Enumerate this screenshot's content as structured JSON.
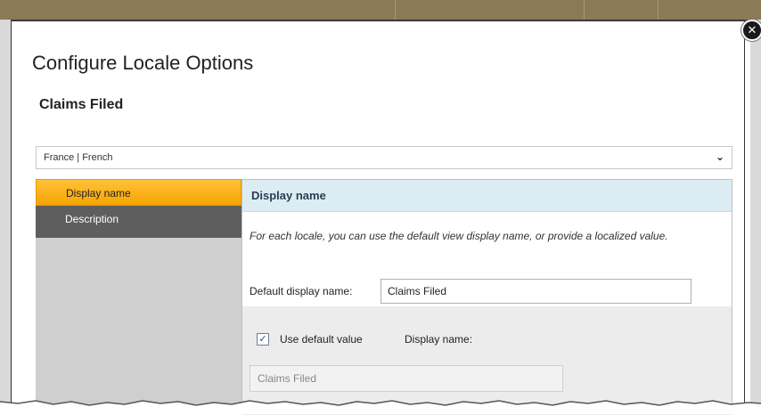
{
  "dialog": {
    "title": "Configure Locale Options",
    "subtitle": "Claims Filed",
    "close_icon": "close-icon",
    "locale_selected": "France | French",
    "chevron_icon": "chevron-down-icon"
  },
  "nav": {
    "items": [
      {
        "label": "Display name",
        "active": true
      },
      {
        "label": "Description",
        "active": false
      }
    ]
  },
  "panel": {
    "header": "Display name",
    "help_text": "For each locale, you can use the default view display name, or provide a localized value.",
    "default_label": "Default display name:",
    "default_value": "Claims Filed",
    "use_default_label": "Use default value",
    "use_default_checked": true,
    "display_name_label": "Display name:",
    "display_name_value": "Claims Filed"
  },
  "colors": {
    "accent": "#f5a400",
    "header_bg": "#dcecf3",
    "nav_dark": "#5e5e5e"
  }
}
